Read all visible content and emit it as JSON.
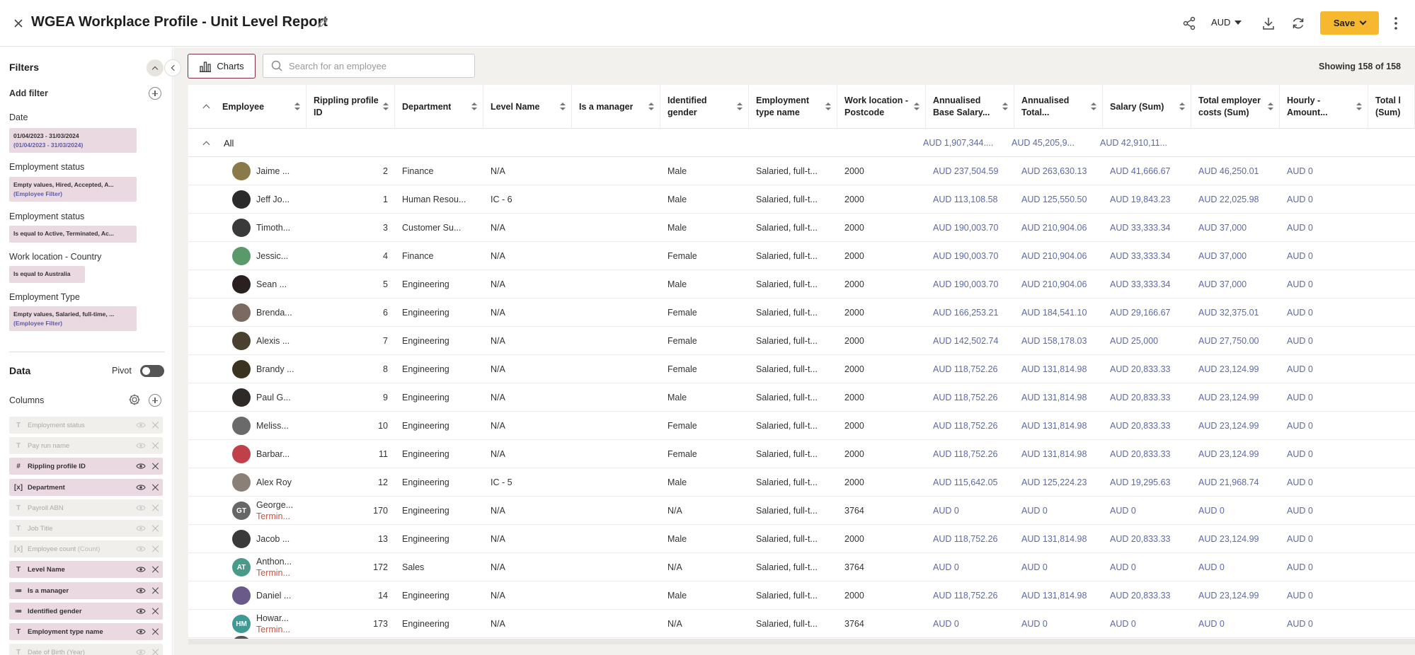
{
  "header": {
    "title": "WGEA Workplace Profile - Unit Level Report",
    "currency": "AUD",
    "save_label": "Save"
  },
  "sidebar": {
    "filters_title": "Filters",
    "add_filter": "Add filter",
    "filters": [
      {
        "label": "Date",
        "value": "01/04/2023 - 31/03/2024",
        "sub": "(01/04/2023 - 31/03/2024)"
      },
      {
        "label": "Employment status",
        "value": "Empty values, Hired, Accepted, A...",
        "sub": "(Employee Filter)"
      },
      {
        "label": "Employment status",
        "value": "Is equal to Active, Terminated, Ac..."
      },
      {
        "label": "Work location - Country",
        "value": "Is equal to Australia"
      },
      {
        "label": "Employment Type",
        "value": "Empty values, Salaried, full-time, ...",
        "sub": "(Employee Filter)"
      }
    ],
    "data_title": "Data",
    "pivot_label": "Pivot",
    "columns_label": "Columns",
    "columns": [
      {
        "type": "T",
        "name": "Employment status",
        "active": false
      },
      {
        "type": "T",
        "name": "Pay run name",
        "active": false
      },
      {
        "type": "#",
        "name": "Rippling profile ID",
        "active": true
      },
      {
        "type": "[x]",
        "name": "Department",
        "active": true
      },
      {
        "type": "T",
        "name": "Payroll ABN",
        "active": false
      },
      {
        "type": "T",
        "name": "Job Title",
        "active": false
      },
      {
        "type": "[x]",
        "name": "Employee count",
        "suffix": "(Count)",
        "active": false
      },
      {
        "type": "T",
        "name": "Level Name",
        "active": true
      },
      {
        "type": "≔",
        "name": "Is a manager",
        "active": true
      },
      {
        "type": "≔",
        "name": "Identified gender",
        "active": true
      },
      {
        "type": "T",
        "name": "Employment type name",
        "active": true
      },
      {
        "type": "T",
        "name": "Date of Birth (Year)",
        "active": false
      }
    ]
  },
  "toolbar": {
    "charts_label": "Charts",
    "search_placeholder": "Search for an employee",
    "showing": "Showing 158 of 158"
  },
  "table": {
    "columns": [
      "Employee",
      "Rippling profile ID",
      "Department",
      "Level Name",
      "Is a manager",
      "Identified gender",
      "Employment type name",
      "Work location - Postcode",
      "Annualised Base Salary...",
      "Annualised Total...",
      "Salary (Sum)",
      "Total employer costs (Sum)",
      "Hourly - Amount...",
      "Total l (Sum)"
    ],
    "all_label": "All",
    "all_totals": [
      "AUD 1,907,344....",
      "AUD 45,205,9...",
      "AUD 42,910,11..."
    ],
    "rows": [
      {
        "initials": "",
        "avatar": "#8a7a4a",
        "name": "Jaime ...",
        "status": "",
        "id": "2",
        "dept": "Finance",
        "level": "N/A",
        "manager": "",
        "gender": "Male",
        "etype": "Salaried, full-t...",
        "postcode": "2000",
        "base": "AUD 237,504.59",
        "total": "AUD 263,630.13",
        "salary": "AUD 41,666.67",
        "costs": "AUD 46,250.01",
        "hourly": "AUD 0"
      },
      {
        "initials": "",
        "avatar": "#2b2b2b",
        "name": "Jeff Jo...",
        "status": "",
        "id": "1",
        "dept": "Human Resou...",
        "level": "IC - 6",
        "manager": "",
        "gender": "Male",
        "etype": "Salaried, full-t...",
        "postcode": "2000",
        "base": "AUD 113,108.58",
        "total": "AUD 125,550.50",
        "salary": "AUD 19,843.23",
        "costs": "AUD 22,025.98",
        "hourly": "AUD 0"
      },
      {
        "initials": "",
        "avatar": "#3a3a3a",
        "name": "Timoth...",
        "status": "",
        "id": "3",
        "dept": "Customer Su...",
        "level": "N/A",
        "manager": "",
        "gender": "Male",
        "etype": "Salaried, full-t...",
        "postcode": "2000",
        "base": "AUD 190,003.70",
        "total": "AUD 210,904.06",
        "salary": "AUD 33,333.34",
        "costs": "AUD 37,000",
        "hourly": "AUD 0"
      },
      {
        "initials": "",
        "avatar": "#5a9a6a",
        "name": "Jessic...",
        "status": "",
        "id": "4",
        "dept": "Finance",
        "level": "N/A",
        "manager": "",
        "gender": "Female",
        "etype": "Salaried, full-t...",
        "postcode": "2000",
        "base": "AUD 190,003.70",
        "total": "AUD 210,904.06",
        "salary": "AUD 33,333.34",
        "costs": "AUD 37,000",
        "hourly": "AUD 0"
      },
      {
        "initials": "",
        "avatar": "#2a2020",
        "name": "Sean ...",
        "status": "",
        "id": "5",
        "dept": "Engineering",
        "level": "N/A",
        "manager": "",
        "gender": "Male",
        "etype": "Salaried, full-t...",
        "postcode": "2000",
        "base": "AUD 190,003.70",
        "total": "AUD 210,904.06",
        "salary": "AUD 33,333.34",
        "costs": "AUD 37,000",
        "hourly": "AUD 0"
      },
      {
        "initials": "",
        "avatar": "#7a6a62",
        "name": "Brenda...",
        "status": "",
        "id": "6",
        "dept": "Engineering",
        "level": "N/A",
        "manager": "",
        "gender": "Female",
        "etype": "Salaried, full-t...",
        "postcode": "2000",
        "base": "AUD 166,253.21",
        "total": "AUD 184,541.10",
        "salary": "AUD 29,166.67",
        "costs": "AUD 32,375.01",
        "hourly": "AUD 0"
      },
      {
        "initials": "",
        "avatar": "#4a4030",
        "name": "Alexis ...",
        "status": "",
        "id": "7",
        "dept": "Engineering",
        "level": "N/A",
        "manager": "",
        "gender": "Female",
        "etype": "Salaried, full-t...",
        "postcode": "2000",
        "base": "AUD 142,502.74",
        "total": "AUD 158,178.03",
        "salary": "AUD 25,000",
        "costs": "AUD 27,750.00",
        "hourly": "AUD 0"
      },
      {
        "initials": "",
        "avatar": "#3a3320",
        "name": "Brandy ...",
        "status": "",
        "id": "8",
        "dept": "Engineering",
        "level": "N/A",
        "manager": "",
        "gender": "Female",
        "etype": "Salaried, full-t...",
        "postcode": "2000",
        "base": "AUD 118,752.26",
        "total": "AUD 131,814.98",
        "salary": "AUD 20,833.33",
        "costs": "AUD 23,124.99",
        "hourly": "AUD 0"
      },
      {
        "initials": "",
        "avatar": "#2d2a28",
        "name": "Paul G...",
        "status": "",
        "id": "9",
        "dept": "Engineering",
        "level": "N/A",
        "manager": "",
        "gender": "Male",
        "etype": "Salaried, full-t...",
        "postcode": "2000",
        "base": "AUD 118,752.26",
        "total": "AUD 131,814.98",
        "salary": "AUD 20,833.33",
        "costs": "AUD 23,124.99",
        "hourly": "AUD 0"
      },
      {
        "initials": "",
        "avatar": "#6a6a6a",
        "name": "Meliss...",
        "status": "",
        "id": "10",
        "dept": "Engineering",
        "level": "N/A",
        "manager": "",
        "gender": "Female",
        "etype": "Salaried, full-t...",
        "postcode": "2000",
        "base": "AUD 118,752.26",
        "total": "AUD 131,814.98",
        "salary": "AUD 20,833.33",
        "costs": "AUD 23,124.99",
        "hourly": "AUD 0"
      },
      {
        "initials": "",
        "avatar": "#c0404a",
        "name": "Barbar...",
        "status": "",
        "id": "11",
        "dept": "Engineering",
        "level": "N/A",
        "manager": "",
        "gender": "Female",
        "etype": "Salaried, full-t...",
        "postcode": "2000",
        "base": "AUD 118,752.26",
        "total": "AUD 131,814.98",
        "salary": "AUD 20,833.33",
        "costs": "AUD 23,124.99",
        "hourly": "AUD 0"
      },
      {
        "initials": "",
        "avatar": "#8a8078",
        "name": "Alex Roy",
        "status": "",
        "id": "12",
        "dept": "Engineering",
        "level": "IC - 5",
        "manager": "",
        "gender": "Male",
        "etype": "Salaried, full-t...",
        "postcode": "2000",
        "base": "AUD 115,642.05",
        "total": "AUD 125,224.23",
        "salary": "AUD 19,295.63",
        "costs": "AUD 21,968.74",
        "hourly": "AUD 0"
      },
      {
        "initials": "GT",
        "avatar": "#666666",
        "name": "George...",
        "status": "Termin...",
        "id": "170",
        "dept": "Engineering",
        "level": "N/A",
        "manager": "",
        "gender": "N/A",
        "etype": "Salaried, full-t...",
        "postcode": "3764",
        "base": "AUD 0",
        "total": "AUD 0",
        "salary": "AUD 0",
        "costs": "AUD 0",
        "hourly": "AUD 0"
      },
      {
        "initials": "",
        "avatar": "#3a3a3a",
        "name": "Jacob ...",
        "status": "",
        "id": "13",
        "dept": "Engineering",
        "level": "N/A",
        "manager": "",
        "gender": "Male",
        "etype": "Salaried, full-t...",
        "postcode": "2000",
        "base": "AUD 118,752.26",
        "total": "AUD 131,814.98",
        "salary": "AUD 20,833.33",
        "costs": "AUD 23,124.99",
        "hourly": "AUD 0"
      },
      {
        "initials": "AT",
        "avatar": "#4a9a8a",
        "name": "Anthon...",
        "status": "Termin...",
        "id": "172",
        "dept": "Sales",
        "level": "N/A",
        "manager": "",
        "gender": "N/A",
        "etype": "Salaried, full-t...",
        "postcode": "3764",
        "base": "AUD 0",
        "total": "AUD 0",
        "salary": "AUD 0",
        "costs": "AUD 0",
        "hourly": "AUD 0"
      },
      {
        "initials": "",
        "avatar": "#6a5a8a",
        "name": "Daniel ...",
        "status": "",
        "id": "14",
        "dept": "Engineering",
        "level": "N/A",
        "manager": "",
        "gender": "Male",
        "etype": "Salaried, full-t...",
        "postcode": "2000",
        "base": "AUD 118,752.26",
        "total": "AUD 131,814.98",
        "salary": "AUD 20,833.33",
        "costs": "AUD 23,124.99",
        "hourly": "AUD 0"
      },
      {
        "initials": "HM",
        "avatar": "#3f9a96",
        "name": "Howar...",
        "status": "Termin...",
        "id": "173",
        "dept": "Engineering",
        "level": "N/A",
        "manager": "",
        "gender": "N/A",
        "etype": "Salaried, full-t...",
        "postcode": "3764",
        "base": "AUD 0",
        "total": "AUD 0",
        "salary": "AUD 0",
        "costs": "AUD 0",
        "hourly": "AUD 0"
      }
    ]
  },
  "colors": {
    "accent": "#f5b82e",
    "chip": "#ead9e1",
    "link": "#5b6aa8",
    "terminated": "#c8553d",
    "charts_border": "#7b2d45"
  }
}
